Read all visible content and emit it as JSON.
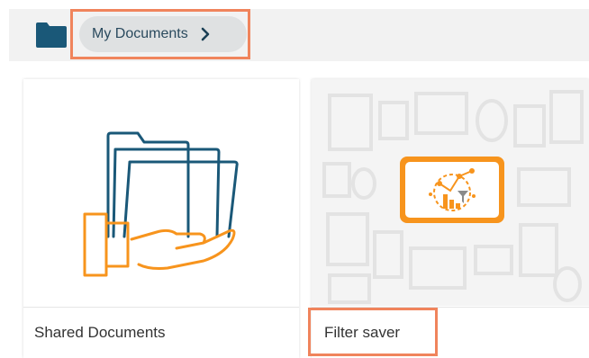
{
  "breadcrumb": {
    "root_icon": "folder-icon",
    "current_label": "My Documents",
    "chevron_icon": "chevron-right-icon"
  },
  "cards": [
    {
      "label": "Shared Documents",
      "icon": "folder-in-hand-icon"
    },
    {
      "label": "Filter saver",
      "icon": "analytics-filter-icon"
    }
  ],
  "colors": {
    "accent_orange": "#f7941d",
    "folder_blue": "#1a5878",
    "highlight": "#f0845c",
    "breadcrumb_bg": "#f2f2f2",
    "pill_bg": "#dfe1e2"
  }
}
